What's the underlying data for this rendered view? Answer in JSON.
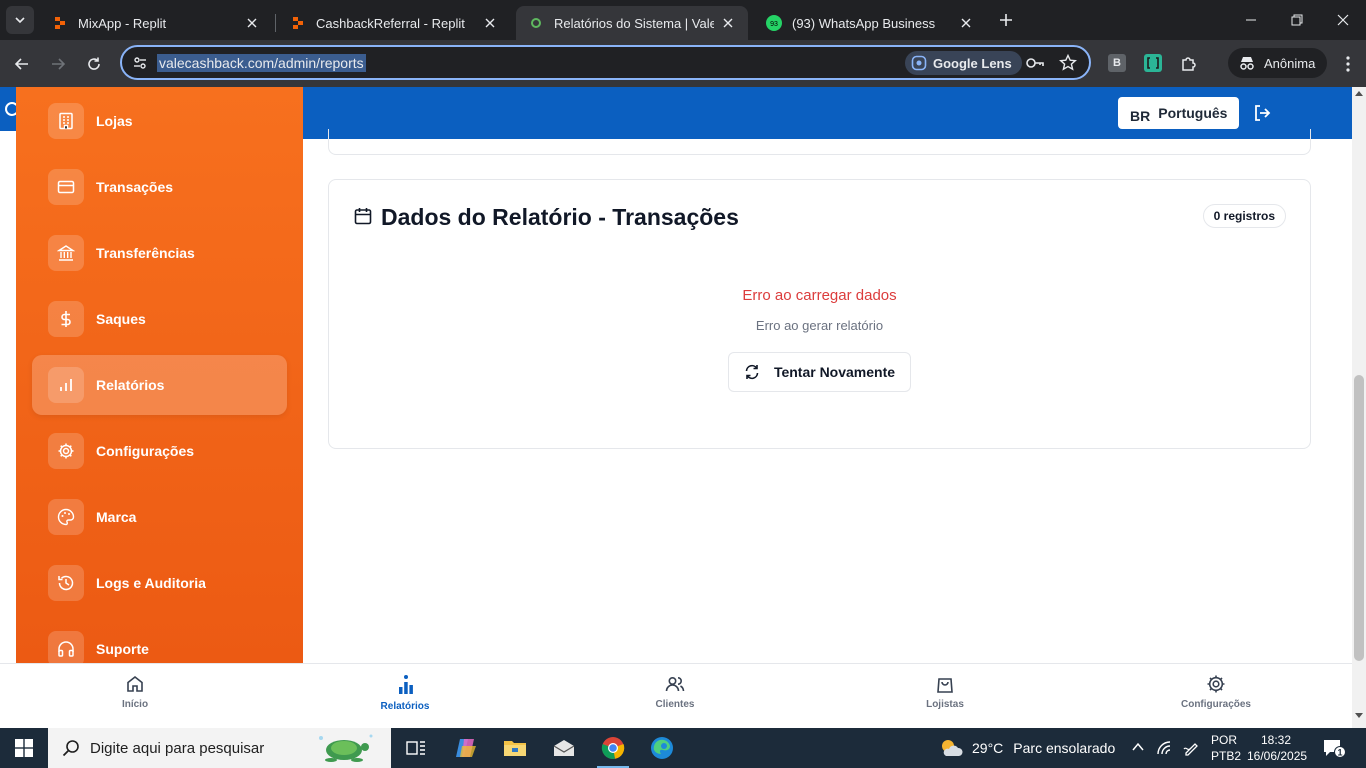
{
  "browser": {
    "tabs": [
      {
        "title": "MixApp - Replit",
        "active": false
      },
      {
        "title": "CashbackReferral - Replit",
        "active": false
      },
      {
        "title": "Relatórios do Sistema | Vale Cas",
        "active": true
      },
      {
        "title": "(93) WhatsApp Business",
        "active": false,
        "badge": "93"
      }
    ],
    "url": "valecashback.com/admin/reports",
    "lens_label": "Google Lens",
    "extension_b": "B",
    "profile_label": "Anônima"
  },
  "header": {
    "lang_code": "BR",
    "lang_label": "Português"
  },
  "sidebar": {
    "items": [
      {
        "label": "Lojas",
        "icon": "building-icon",
        "active": false
      },
      {
        "label": "Transações",
        "icon": "credit-card-icon",
        "active": false
      },
      {
        "label": "Transferências",
        "icon": "bank-icon",
        "active": false
      },
      {
        "label": "Saques",
        "icon": "dollar-icon",
        "active": false
      },
      {
        "label": "Relatórios",
        "icon": "bar-chart-icon",
        "active": true
      },
      {
        "label": "Configurações",
        "icon": "gear-icon",
        "active": false
      },
      {
        "label": "Marca",
        "icon": "palette-icon",
        "active": false
      },
      {
        "label": "Logs e Auditoria",
        "icon": "history-icon",
        "active": false
      },
      {
        "label": "Suporte",
        "icon": "headphones-icon",
        "active": false
      }
    ]
  },
  "report": {
    "title": "Dados do Relatório - Transações",
    "count_badge": "0 registros",
    "error_title": "Erro ao carregar dados",
    "error_message": "Erro ao gerar relatório",
    "retry_label": "Tentar Novamente"
  },
  "bottom_nav": {
    "items": [
      {
        "label": "Início",
        "icon": "home-icon",
        "active": false
      },
      {
        "label": "Relatórios",
        "icon": "bar-chart-icon",
        "active": true
      },
      {
        "label": "Clientes",
        "icon": "users-icon",
        "active": false
      },
      {
        "label": "Lojistas",
        "icon": "shopping-bag-icon",
        "active": false
      },
      {
        "label": "Configurações",
        "icon": "gear-icon",
        "active": false
      }
    ]
  },
  "taskbar": {
    "search_placeholder": "Digite aqui para pesquisar",
    "temperature": "29°C",
    "weather_text": "Parc ensolarado",
    "lang_line1": "POR",
    "lang_line2": "PTB2",
    "time": "18:32",
    "date": "16/06/2025",
    "notification_count": "1"
  },
  "colors": {
    "sidebar_orange": "#f7701e",
    "header_blue": "#0b5fc0",
    "error_red": "#dc3c3c"
  }
}
